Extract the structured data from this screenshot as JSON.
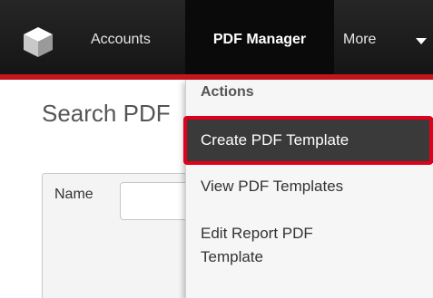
{
  "nav": {
    "items": [
      {
        "label": "Accounts"
      },
      {
        "label": "PDF Manager"
      },
      {
        "label": "More"
      }
    ],
    "accent_color": "#c4161c"
  },
  "page": {
    "title": "Search PDF",
    "search": {
      "name_label": "Name",
      "name_value": ""
    }
  },
  "dropdown": {
    "header": "Actions",
    "items": [
      {
        "label": "Create PDF Template",
        "state": "highlighted"
      },
      {
        "label": "View PDF Templates"
      },
      {
        "label": "Edit Report PDF Template"
      }
    ],
    "highlight_outline_color": "#e0001b"
  }
}
